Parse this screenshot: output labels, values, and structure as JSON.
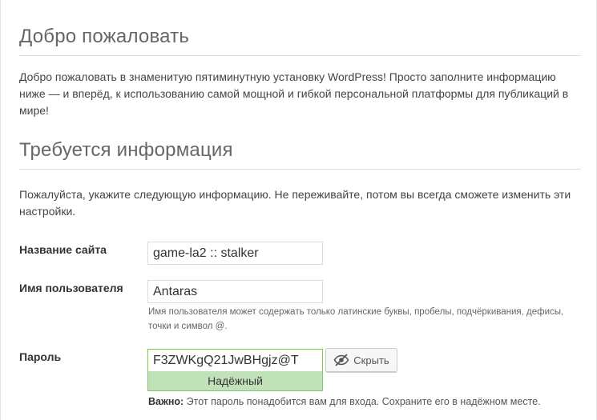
{
  "welcome": {
    "heading": "Добро пожаловать",
    "text": "Добро пожаловать в знаменитую пятиминутную установку WordPress! Просто заполните информацию ниже — и вперёд, к использованию самой мощной и гибкой персональной платформы для публикаций в мире!"
  },
  "info": {
    "heading": "Требуется информация",
    "text": "Пожалуйста, укажите следующую информацию. Не переживайте, потом вы всегда сможете изменить эти настройки."
  },
  "form": {
    "site_title": {
      "label": "Название сайта",
      "value": "game-la2 :: stalker"
    },
    "username": {
      "label": "Имя пользователя",
      "value": "Antaras",
      "hint": "Имя пользователя может содержать только латинские буквы, пробелы, подчёркивания, дефисы, точки и символ @."
    },
    "password": {
      "label": "Пароль",
      "value": "F3ZWKgQ21JwBHgjz@T",
      "strength": "Надёжный",
      "hide_label": "Скрыть",
      "hide_icon": "eye-slash-icon",
      "note_strong": "Важно:",
      "note_text": " Этот пароль понадобится вам для входа. Сохраните его в надёжном месте."
    }
  },
  "colors": {
    "strength_bg": "#c1e1b9",
    "strength_border": "#83c373"
  }
}
